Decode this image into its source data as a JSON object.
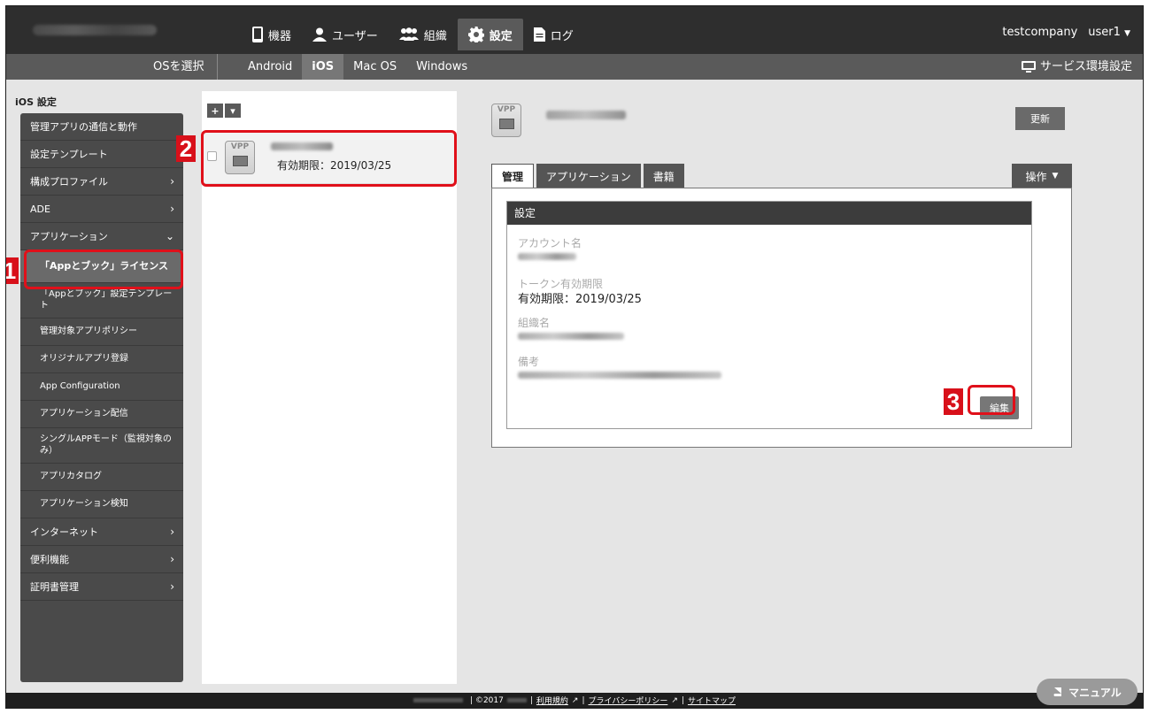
{
  "topnav": {
    "items": [
      {
        "label": "機器",
        "icon": "device-icon"
      },
      {
        "label": "ユーザー",
        "icon": "user-icon"
      },
      {
        "label": "組織",
        "icon": "group-icon"
      },
      {
        "label": "設定",
        "icon": "gear-icon"
      },
      {
        "label": "ログ",
        "icon": "document-icon"
      }
    ],
    "active": "設定",
    "company": "testcompany",
    "user": "user1"
  },
  "subnav": {
    "os_label": "OSを選択",
    "tabs": [
      "Android",
      "iOS",
      "Mac OS",
      "Windows"
    ],
    "active_tab": "iOS",
    "service_settings": "サービス環境設定"
  },
  "sidebar": {
    "title": "iOS 設定",
    "items": [
      {
        "label": "管理アプリの通信と動作"
      },
      {
        "label": "設定テンプレート"
      },
      {
        "label": "構成プロファイル"
      },
      {
        "label": "ADE"
      },
      {
        "label": "アプリケーション"
      },
      {
        "label": "インターネット"
      },
      {
        "label": "便利機能"
      },
      {
        "label": "証明書管理"
      }
    ],
    "app_sub_items": [
      "「Appとブック」ライセンス",
      "「Appとブック」設定テンプレート",
      "管理対象アプリポリシー",
      "オリジナルアプリ登録",
      "App Configuration",
      "アプリケーション配信",
      "シングルAPPモード（監視対象のみ）",
      "アプリカタログ",
      "アプリケーション検知"
    ],
    "active_sub": "「Appとブック」ライセンス"
  },
  "list": {
    "add_button": "+",
    "dropdown_button": "▾",
    "rows": [
      {
        "expiry": "有効期限：2019/03/25",
        "icon_text": "VPP"
      }
    ]
  },
  "detail": {
    "icon_text": "VPP",
    "refresh_button": "更新",
    "tabs": [
      "管理",
      "アプリケーション",
      "書籍"
    ],
    "active_tab": "管理",
    "ops_button": "操作",
    "section_title": "設定",
    "fields": {
      "account_label": "アカウント名",
      "token_label": "トークン有効期限",
      "token_value": "有効期限：2019/03/25",
      "org_label": "組織名",
      "note_label": "備考"
    },
    "edit_button": "編集"
  },
  "annotations": {
    "step1": "1",
    "step2": "2",
    "step3": "3",
    "highlight_color": "#e0101a"
  },
  "footer": {
    "copyright": "| ©2017",
    "terms": "利用規約",
    "privacy": "プライバシーポリシー",
    "sitemap": "サイトマップ"
  },
  "manual_button": "マニュアル"
}
